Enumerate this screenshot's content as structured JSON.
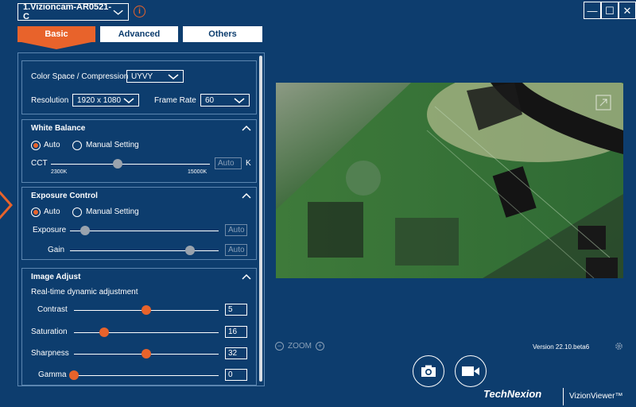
{
  "device": {
    "name": "1.Vizioncam-AR0521-C"
  },
  "window_controls": {
    "minimize": "—",
    "maximize": "☐",
    "close": "✕"
  },
  "tabs": {
    "basic": "Basic",
    "advanced": "Advanced",
    "others": "Others"
  },
  "format": {
    "color_space_label": "Color Space / Compression",
    "color_space_value": "UYVY",
    "resolution_label": "Resolution",
    "resolution_value": "1920 x 1080",
    "frame_rate_label": "Frame Rate",
    "frame_rate_value": "60"
  },
  "white_balance": {
    "title": "White Balance",
    "auto_label": "Auto",
    "manual_label": "Manual Setting",
    "cct_label": "CCT",
    "cct_min": "2300K",
    "cct_max": "15000K",
    "cct_value_placeholder": "Auto",
    "cct_unit": "K",
    "cct_level": 0.42
  },
  "exposure": {
    "title": "Exposure Control",
    "auto_label": "Auto",
    "manual_label": "Manual Setting",
    "exposure_label": "Exposure",
    "exposure_value": "Auto",
    "exposure_level": 0.1,
    "gain_label": "Gain",
    "gain_value": "Auto",
    "gain_level": 0.81
  },
  "image_adjust": {
    "title": "Image Adjust",
    "subtitle": "Real-time dynamic adjustment",
    "contrast_label": "Contrast",
    "contrast_value": "5",
    "contrast_level": 0.5,
    "saturation_label": "Saturation",
    "saturation_value": "16",
    "saturation_level": 0.21,
    "sharpness_label": "Sharpness",
    "sharpness_value": "32",
    "sharpness_level": 0.5,
    "gamma_label": "Gamma",
    "gamma_value": "0",
    "gamma_level": 0.0
  },
  "zoom": {
    "label": "ZOOM"
  },
  "version": "Version 22.10.beta6",
  "brand": {
    "company": "TechNexion",
    "product": "VizionViewer™"
  },
  "colors": {
    "accent": "#e8632b",
    "background": "#0d3d6e",
    "border": "#5c86b0"
  }
}
